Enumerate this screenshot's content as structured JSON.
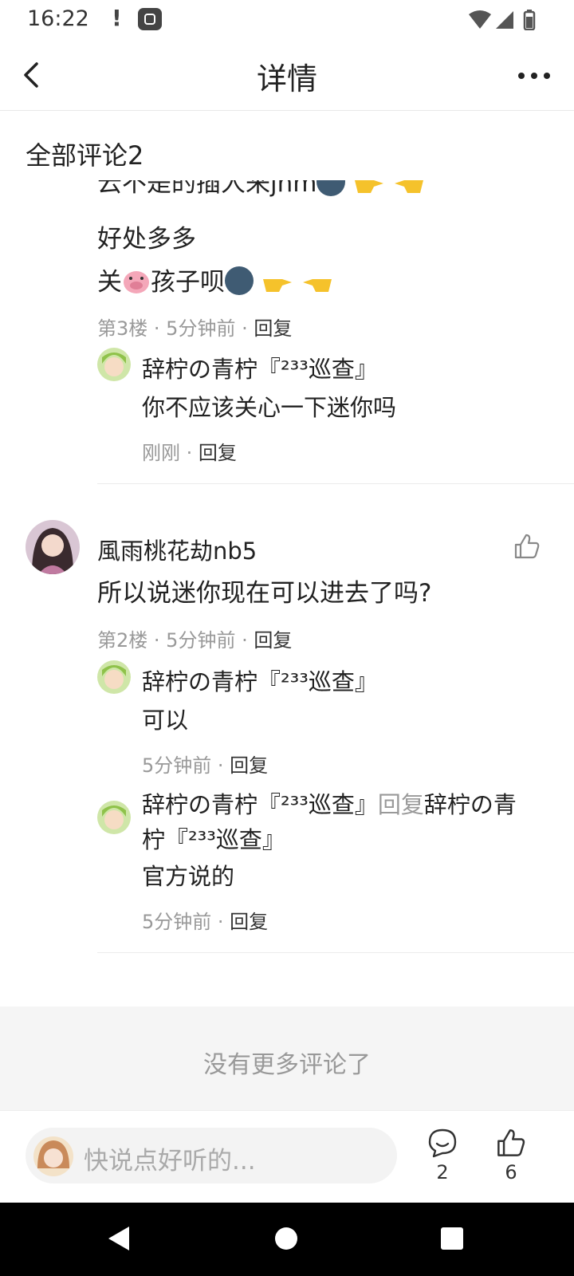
{
  "status_bar": {
    "time": "16:22",
    "alert": "!"
  },
  "header": {
    "title": "详情"
  },
  "section": {
    "all_comments": "全部评论2"
  },
  "comment3": {
    "lines": [
      "云不是的插人来jhm",
      "好处多多",
      "关",
      "孩子呗"
    ],
    "floor": "第3楼",
    "time": "5分钟前",
    "reply_label": "回复",
    "sub_replies": [
      {
        "author": "辞柠の青柠『²³³巡查』",
        "text": "你不应该关心一下迷你吗",
        "time": "刚刚",
        "reply_label": "回复"
      }
    ]
  },
  "comment2": {
    "author": "風雨桃花劫nb5",
    "text": "所以说迷你现在可以进去了吗?",
    "floor": "第2楼",
    "time": "5分钟前",
    "reply_label": "回复",
    "sub_replies": [
      {
        "author": "辞柠の青柠『²³³巡查』",
        "text": "可以",
        "time": "5分钟前",
        "reply_label": "回复"
      },
      {
        "author": "辞柠の青柠『²³³巡查』",
        "reply_word": "回复",
        "target_line1": "辞柠の青",
        "target_line2": "柠『²³³巡查』",
        "text": "官方说的",
        "time": "5分钟前",
        "reply_label": "回复"
      }
    ]
  },
  "footer": {
    "no_more": "没有更多评论了"
  },
  "bottom_bar": {
    "placeholder": "快说点好听的...",
    "comment_count": "2",
    "like_count": "6"
  },
  "icons": {
    "back": "back-arrow-icon",
    "more": "more-dots-icon",
    "like": "thumbs-up-icon",
    "comment": "comment-bubble-icon"
  },
  "colors": {
    "accent_gray": "#999999",
    "text": "#222222",
    "band": "#f5f5f5"
  }
}
